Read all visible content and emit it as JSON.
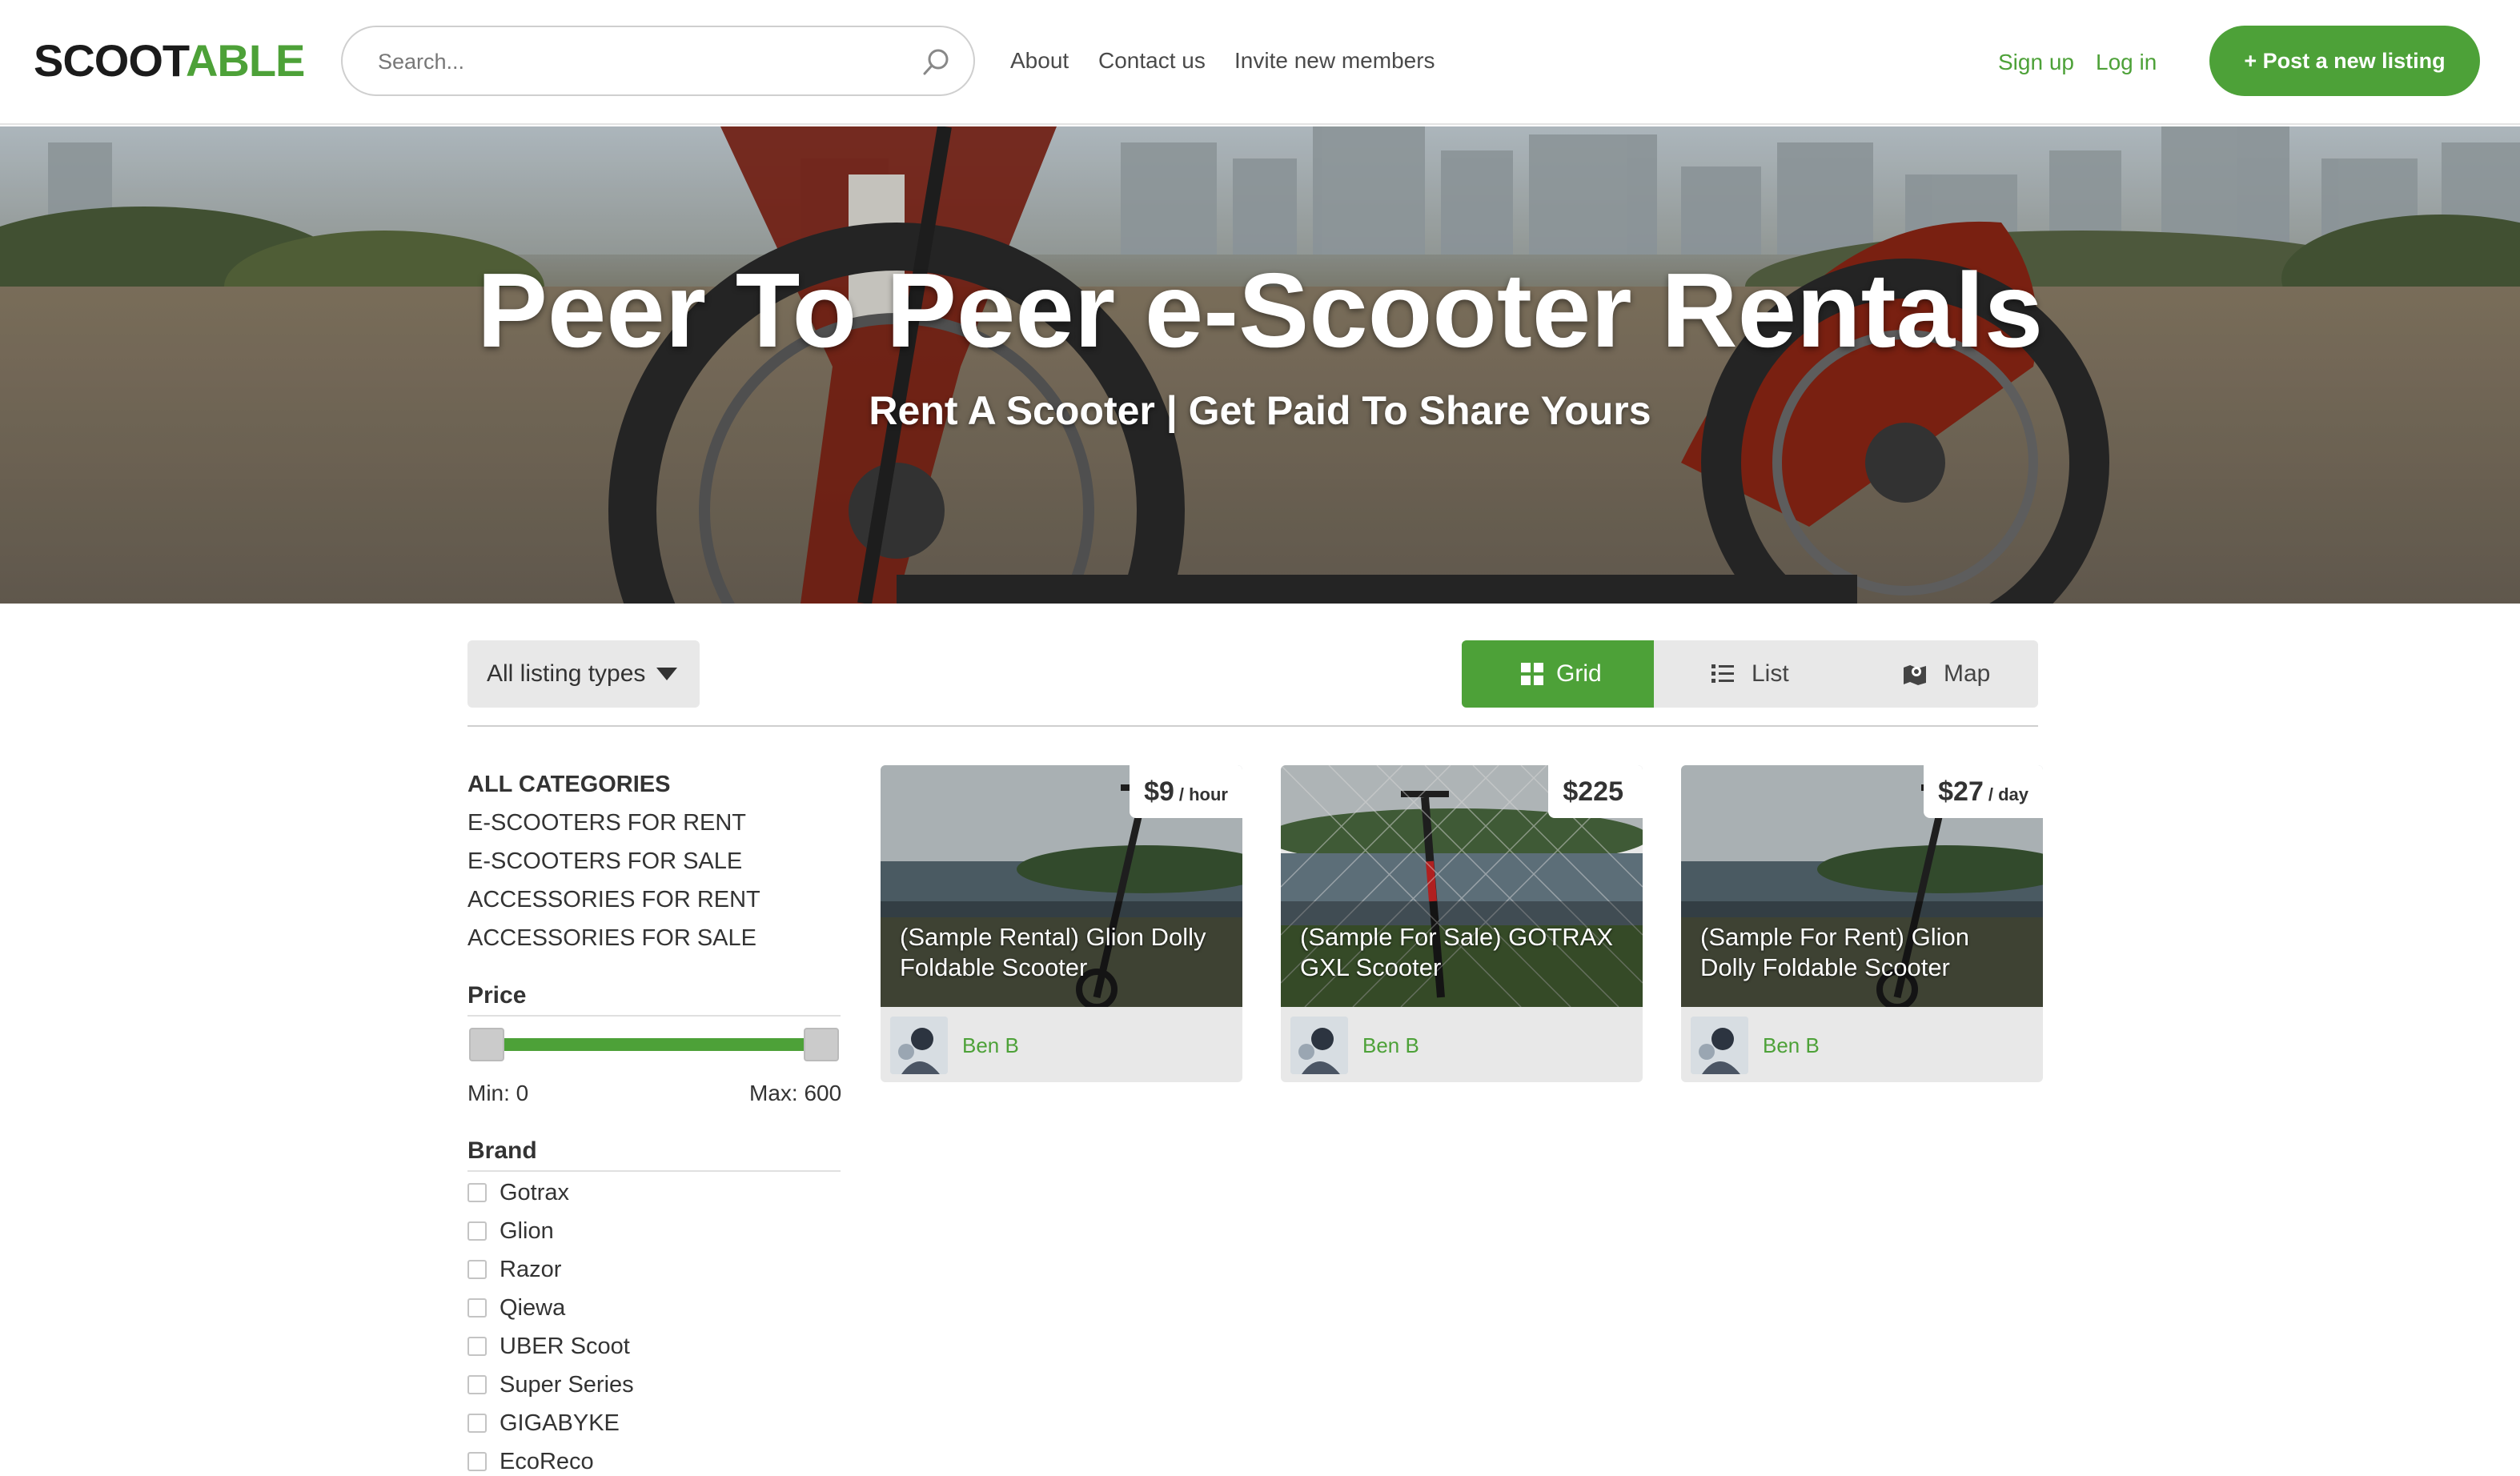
{
  "header": {
    "logo_part1": "SCOOT",
    "logo_part2": "ABLE",
    "search_placeholder": "Search...",
    "nav": [
      "About",
      "Contact us",
      "Invite new members"
    ],
    "signup": "Sign up",
    "login": "Log in",
    "post_listing": "+ Post a new listing"
  },
  "hero": {
    "title": "Peer To Peer e-Scooter Rentals",
    "subtitle": "Rent A Scooter | Get Paid To Share Yours"
  },
  "toolbar": {
    "listing_types": "All listing types",
    "views": [
      {
        "label": "Grid",
        "icon": "grid-icon",
        "active": true
      },
      {
        "label": "List",
        "icon": "list-icon",
        "active": false
      },
      {
        "label": "Map",
        "icon": "map-icon",
        "active": false
      }
    ]
  },
  "sidebar": {
    "categories": [
      "ALL CATEGORIES",
      "E-SCOOTERS FOR RENT",
      "E-SCOOTERS FOR SALE",
      "ACCESSORIES FOR RENT",
      "ACCESSORIES FOR SALE"
    ],
    "price": {
      "heading": "Price",
      "min_label": "Min: 0",
      "max_label": "Max: 600",
      "min_value": 0,
      "max_value": 600
    },
    "brand": {
      "heading": "Brand",
      "options": [
        "Gotrax",
        "Glion",
        "Razor",
        "Qiewa",
        "UBER Scoot",
        "Super Series",
        "GIGABYKE",
        "EcoReco"
      ]
    }
  },
  "listings": [
    {
      "price": "$9",
      "unit": "/ hour",
      "title": "(Sample Rental) Glion Dolly Foldable Scooter",
      "author": "Ben B"
    },
    {
      "price": "$225",
      "unit": "",
      "title": "(Sample For Sale) GOTRAX GXL Scooter",
      "author": "Ben B"
    },
    {
      "price": "$27",
      "unit": "/ day",
      "title": "(Sample For Rent) Glion Dolly Foldable Scooter",
      "author": "Ben B"
    }
  ],
  "colors": {
    "brand_green": "#4da138",
    "logo_dark": "#1b1b1b"
  }
}
